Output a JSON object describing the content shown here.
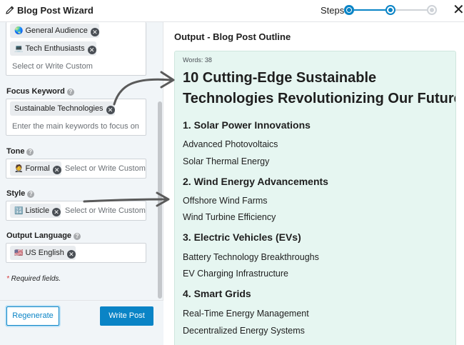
{
  "header": {
    "title": "Blog Post Wizard",
    "steps_label": "Steps",
    "steps": [
      {
        "state": "complete"
      },
      {
        "state": "current"
      },
      {
        "state": "upcoming"
      }
    ],
    "accent_color": "#0a84c6"
  },
  "left": {
    "audience": {
      "chips": [
        {
          "emoji": "🌏",
          "label": "General Audience"
        },
        {
          "emoji": "💻",
          "label": "Tech Enthusiasts"
        }
      ],
      "placeholder": "Select or Write Custom"
    },
    "focus_keyword": {
      "label": "Focus Keyword",
      "chip": "Sustainable Technologies",
      "placeholder": "Enter the main keywords to focus on"
    },
    "tone": {
      "label": "Tone",
      "chip_emoji": "🤵",
      "chip": "Formal",
      "placeholder": "Select or Write Custom"
    },
    "style": {
      "label": "Style",
      "chip_emoji": "🔢",
      "chip": "Listicle",
      "placeholder": "Select or Write Custom"
    },
    "output_language": {
      "label": "Output Language",
      "chip_emoji": "🇺🇸",
      "chip": "US English"
    },
    "required_note": "Required fields.",
    "buttons": {
      "regenerate": "Regenerate",
      "write": "Write Post"
    }
  },
  "output": {
    "title": "Output - Blog Post Outline",
    "words": "Words: 38",
    "h1_line1": "10 Cutting-Edge Sustainable",
    "h1_line2": "Technologies Revolutionizing Our Future",
    "sections": [
      {
        "heading": "1. Solar Power Innovations",
        "items": [
          "Advanced Photovoltaics",
          "Solar Thermal Energy"
        ]
      },
      {
        "heading": "2. Wind Energy Advancements",
        "items": [
          "Offshore Wind Farms",
          "Wind Turbine Efficiency"
        ]
      },
      {
        "heading": "3. Electric Vehicles (EVs)",
        "items": [
          "Battery Technology Breakthroughs",
          "EV Charging Infrastructure"
        ]
      },
      {
        "heading": "4. Smart Grids",
        "items": [
          "Real-Time Energy Management",
          "Decentralized Energy Systems"
        ]
      }
    ]
  }
}
